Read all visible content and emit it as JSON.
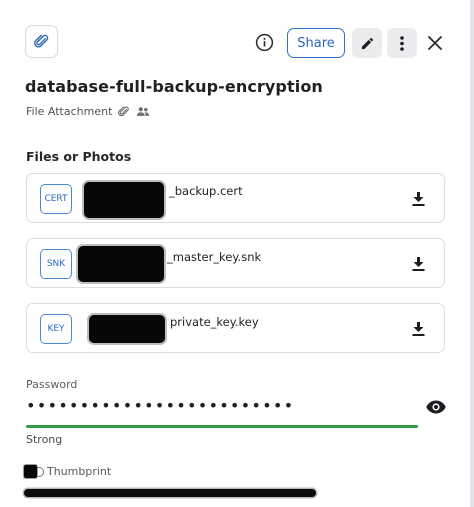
{
  "header": {
    "share_label": "Share",
    "icons": [
      "paperclip-icon",
      "info-icon",
      "pencil-icon",
      "more-vertical-icon",
      "close-icon"
    ]
  },
  "item": {
    "title": "database-full-backup-encryption",
    "type_label": "File Attachment",
    "type_icons": [
      "paperclip-icon",
      "users-icon"
    ]
  },
  "files_section": {
    "label": "Files or Photos",
    "files": [
      {
        "tag": "CERT",
        "name": "_backup.cert"
      },
      {
        "tag": "SNK",
        "name": "_master_key.snk"
      },
      {
        "tag": "KEY",
        "name": "private_key.key"
      }
    ]
  },
  "password": {
    "label": "Password",
    "masked_value": "•••••••••••••••••••••••••",
    "strength_label": "Strong",
    "strength_fraction": 1.0,
    "strength_color": "#2f9d43"
  },
  "thumbprint": {
    "label": "Thumbprint"
  },
  "colors": {
    "accent": "#2d72c8",
    "text": "#1f2024",
    "border": "#dcdde2"
  }
}
